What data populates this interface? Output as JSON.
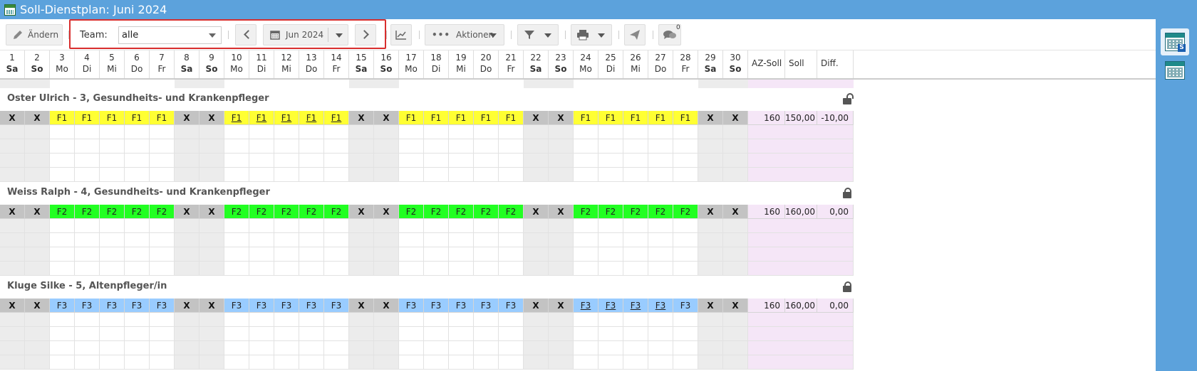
{
  "window": {
    "title": "Soll-Dienstplan: Juni 2024"
  },
  "toolbar": {
    "edit_label": "Ändern",
    "team_label": "Team:",
    "team_value": "alle",
    "month_value": "Jun 2024",
    "actions_label": "Aktionen",
    "messages_count": "0"
  },
  "columns": {
    "days": [
      {
        "n": "1",
        "w": "Sa"
      },
      {
        "n": "2",
        "w": "So"
      },
      {
        "n": "3",
        "w": "Mo"
      },
      {
        "n": "4",
        "w": "Di"
      },
      {
        "n": "5",
        "w": "Mi"
      },
      {
        "n": "6",
        "w": "Do"
      },
      {
        "n": "7",
        "w": "Fr"
      },
      {
        "n": "8",
        "w": "Sa"
      },
      {
        "n": "9",
        "w": "So"
      },
      {
        "n": "10",
        "w": "Mo"
      },
      {
        "n": "11",
        "w": "Di"
      },
      {
        "n": "12",
        "w": "Mi"
      },
      {
        "n": "13",
        "w": "Do"
      },
      {
        "n": "14",
        "w": "Fr"
      },
      {
        "n": "15",
        "w": "Sa"
      },
      {
        "n": "16",
        "w": "So"
      },
      {
        "n": "17",
        "w": "Mo"
      },
      {
        "n": "18",
        "w": "Di"
      },
      {
        "n": "19",
        "w": "Mi"
      },
      {
        "n": "20",
        "w": "Do"
      },
      {
        "n": "21",
        "w": "Fr"
      },
      {
        "n": "22",
        "w": "Sa"
      },
      {
        "n": "23",
        "w": "So"
      },
      {
        "n": "24",
        "w": "Mo"
      },
      {
        "n": "25",
        "w": "Di"
      },
      {
        "n": "26",
        "w": "Mi"
      },
      {
        "n": "27",
        "w": "Do"
      },
      {
        "n": "28",
        "w": "Fr"
      },
      {
        "n": "29",
        "w": "Sa"
      },
      {
        "n": "30",
        "w": "So"
      }
    ],
    "summary": [
      "AZ-Soll",
      "Soll",
      "Diff."
    ]
  },
  "colors": {
    "F1": "#ffff33",
    "F2": "#22ff22",
    "F3": "#99ccff",
    "X": "#c3c3c3",
    "weekend_bg": "#ececec",
    "summary_bg": "#f5e6f7",
    "accent": "#5ca2dc"
  },
  "employees": [
    {
      "name": "Oster Ulrich - 3, Gesundheits- und Krankenpfleger",
      "locked": false,
      "shifts": [
        "X",
        "X",
        "F1",
        "F1",
        "F1",
        "F1",
        "F1",
        "X",
        "X",
        "F1",
        "F1",
        "F1",
        "F1",
        "F1",
        "X",
        "X",
        "F1",
        "F1",
        "F1",
        "F1",
        "F1",
        "X",
        "X",
        "F1",
        "F1",
        "F1",
        "F1",
        "F1",
        "X",
        "X"
      ],
      "underlined_days": [
        "10",
        "11",
        "12",
        "13",
        "14"
      ],
      "az_soll": "160",
      "soll": "150,00",
      "diff": "-10,00"
    },
    {
      "name": "Weiss Ralph - 4, Gesundheits- und Krankenpfleger",
      "locked": true,
      "shifts": [
        "X",
        "X",
        "F2",
        "F2",
        "F2",
        "F2",
        "F2",
        "X",
        "X",
        "F2",
        "F2",
        "F2",
        "F2",
        "F2",
        "X",
        "X",
        "F2",
        "F2",
        "F2",
        "F2",
        "F2",
        "X",
        "X",
        "F2",
        "F2",
        "F2",
        "F2",
        "F2",
        "X",
        "X"
      ],
      "underlined_days": [],
      "az_soll": "160",
      "soll": "160,00",
      "diff": "0,00"
    },
    {
      "name": "Kluge Silke - 5, Altenpfleger/in",
      "locked": true,
      "shifts": [
        "X",
        "X",
        "F3",
        "F3",
        "F3",
        "F3",
        "F3",
        "X",
        "X",
        "F3",
        "F3",
        "F3",
        "F3",
        "F3",
        "X",
        "X",
        "F3",
        "F3",
        "F3",
        "F3",
        "F3",
        "X",
        "X",
        "F3",
        "F3",
        "F3",
        "F3",
        "F3",
        "X",
        "X"
      ],
      "underlined_days": [
        "24",
        "25",
        "26",
        "27"
      ],
      "az_soll": "160",
      "soll": "160,00",
      "diff": "0,00"
    }
  ]
}
